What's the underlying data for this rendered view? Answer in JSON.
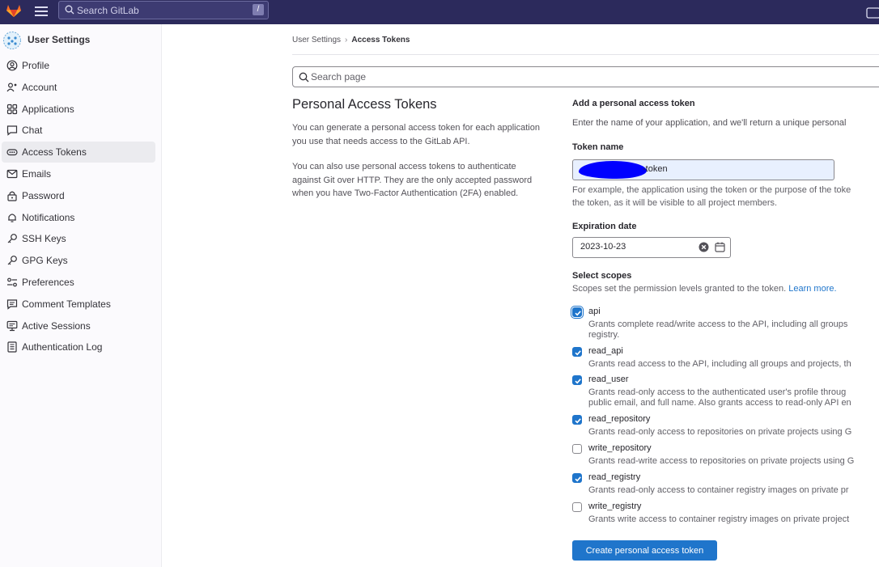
{
  "colors": {
    "topbar_bg": "#2c2a5c",
    "brand_orange": "#fc6d26",
    "accent_blue": "#1f75cb",
    "redaction_blue": "#0000ff"
  },
  "topbar": {
    "search_placeholder": "Search GitLab",
    "search_shortcut": "/",
    "icons": [
      "gitlab-logo-icon",
      "hamburger-menu-icon",
      "search-icon",
      "chat-icon"
    ]
  },
  "sidebar": {
    "title": "User Settings",
    "items": [
      {
        "label": "Profile",
        "icon": "profile-icon"
      },
      {
        "label": "Account",
        "icon": "account-icon"
      },
      {
        "label": "Applications",
        "icon": "applications-icon"
      },
      {
        "label": "Chat",
        "icon": "chat-icon"
      },
      {
        "label": "Access Tokens",
        "icon": "token-icon",
        "active": true
      },
      {
        "label": "Emails",
        "icon": "mail-icon"
      },
      {
        "label": "Password",
        "icon": "lock-icon"
      },
      {
        "label": "Notifications",
        "icon": "bell-icon"
      },
      {
        "label": "SSH Keys",
        "icon": "key-icon"
      },
      {
        "label": "GPG Keys",
        "icon": "key-icon"
      },
      {
        "label": "Preferences",
        "icon": "preferences-icon"
      },
      {
        "label": "Comment Templates",
        "icon": "comment-icon"
      },
      {
        "label": "Active Sessions",
        "icon": "monitor-icon"
      },
      {
        "label": "Authentication Log",
        "icon": "log-icon"
      }
    ]
  },
  "breadcrumb": {
    "parent": "User Settings",
    "separator": "›",
    "current": "Access Tokens"
  },
  "page_search": {
    "placeholder": "Search page"
  },
  "intro": {
    "title": "Personal Access Tokens",
    "p1": "You can generate a personal access token for each application you use that needs access to the GitLab API.",
    "p2": "You can also use personal access tokens to authenticate against Git over HTTP. They are the only accepted password when you have Two-Factor Authentication (2FA) enabled."
  },
  "form": {
    "heading": "Add a personal access token",
    "intro": "Enter the name of your application, and we'll return a unique personal",
    "token_name_label": "Token name",
    "token_name_value": "-token",
    "token_name_help_1": "For example, the application using the token or the purpose of the toke",
    "token_name_help_2": "the token, as it will be visible to all project members.",
    "expiration_label": "Expiration date",
    "expiration_value": "2023-10-23",
    "scopes_label": "Select scopes",
    "scopes_help": "Scopes set the permission levels granted to the token.",
    "learn_more": "Learn more.",
    "scopes": [
      {
        "name": "api",
        "checked": true,
        "focused": true,
        "desc": [
          "Grants complete read/write access to the API, including all groups",
          "registry."
        ]
      },
      {
        "name": "read_api",
        "checked": true,
        "desc": [
          "Grants read access to the API, including all groups and projects, th"
        ]
      },
      {
        "name": "read_user",
        "checked": true,
        "desc": [
          "Grants read-only access to the authenticated user's profile throug",
          "public email, and full name. Also grants access to read-only API en"
        ]
      },
      {
        "name": "read_repository",
        "checked": true,
        "desc": [
          "Grants read-only access to repositories on private projects using G"
        ]
      },
      {
        "name": "write_repository",
        "checked": false,
        "desc": [
          "Grants read-write access to repositories on private projects using G"
        ]
      },
      {
        "name": "read_registry",
        "checked": true,
        "desc": [
          "Grants read-only access to container registry images on private pr"
        ]
      },
      {
        "name": "write_registry",
        "checked": false,
        "desc": [
          "Grants write access to container registry images on private project"
        ]
      }
    ],
    "submit_label": "Create personal access token"
  }
}
